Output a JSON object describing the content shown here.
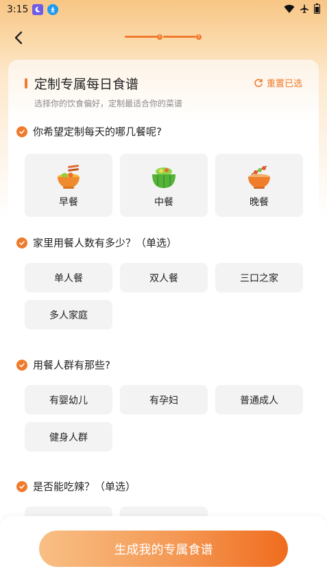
{
  "status_bar": {
    "time": "3:15",
    "icons": [
      "moon-app-icon",
      "download-app-icon",
      "wifi-icon",
      "airplane-icon",
      "battery-icon"
    ]
  },
  "nav": {
    "back_icon": "chevron-left-icon",
    "progress_steps": [
      "1",
      "2"
    ]
  },
  "header": {
    "title": "定制专属每日食谱",
    "reset_label": "重置已选",
    "subtitle": "选择你的饮食偏好，定制最适合你的菜谱"
  },
  "sections": [
    {
      "question": "你希望定制每天的哪几餐呢?",
      "options": [
        "早餐",
        "中餐",
        "晚餐"
      ]
    },
    {
      "question": "家里用餐人数有多少？（单选）",
      "options": [
        "单人餐",
        "双人餐",
        "三口之家",
        "多人家庭"
      ]
    },
    {
      "question": "用餐人群有那些?",
      "options": [
        "有婴幼儿",
        "有孕妇",
        "普通成人",
        "健身人群"
      ]
    },
    {
      "question": "是否能吃辣？（单选）",
      "options": []
    }
  ],
  "footer": {
    "generate_label": "生成我的专属食谱"
  },
  "colors": {
    "accent": "#f07a2b",
    "tile_bg": "#f3f3f3"
  }
}
